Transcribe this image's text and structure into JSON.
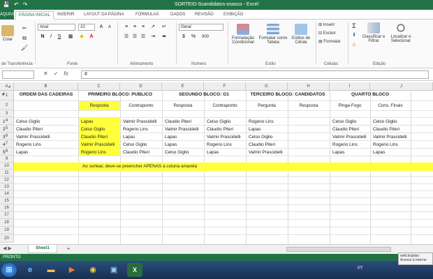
{
  "window": {
    "title": "SORTEIO-Scandidatos-osasco - Excel",
    "quick_access": [
      "💾",
      "↶",
      "↷"
    ]
  },
  "ribbon_tabs": {
    "file": "AQUIVO",
    "items": [
      "PÁGINA INICIAL",
      "INSERIR",
      "LAYOUT DA PÁGINA",
      "FÓRMULAS",
      "DADOS",
      "REVISÃO",
      "EXIBIÇÃO"
    ],
    "active": "PÁGINA INICIAL"
  },
  "ribbon": {
    "paste_label": "Colar",
    "clipboard_label": "de Transferência",
    "font_name": "Arial",
    "font_size": "10",
    "font_group_label": "Fonte",
    "bold": "N",
    "italic": "I",
    "underline": "S",
    "alignment_label": "Alinhamento",
    "number_format": "Geral",
    "number_label": "Número",
    "currency": "$",
    "percent": "%",
    "thousands": "000",
    "conditional_format": "Formatação Condicional",
    "format_table": "Formatar como Tabela",
    "cell_styles": "Estilos de Célula",
    "styles_label": "Estilo",
    "insert": "Inserir",
    "delete": "Excluir",
    "format": "Formatar",
    "cells_label": "Células",
    "sort_filter": "Classificar e Filtrar",
    "find_select": "Localizar e Selecionar",
    "editing_label": "Edição",
    "accent_color": "#217346"
  },
  "formula_bar": {
    "name_box": "",
    "fx": "fx",
    "content": "#"
  },
  "columns": [
    "A",
    "B",
    "C",
    "D",
    "E",
    "F",
    "G",
    "H",
    "I",
    "J"
  ],
  "rows": [
    "1",
    "2",
    "3",
    "4",
    "5",
    "6",
    "7",
    "8",
    "9",
    "10",
    "11",
    "12",
    "13",
    "14",
    "15",
    "16",
    "17",
    "18",
    "19",
    "20"
  ],
  "sheet": {
    "hash": "#",
    "order_header": "ORDEM DAS CADEIRAS",
    "block1": "PRIMEIRO BLOCO: PÚBLICO",
    "block2": "SEGUNDO BLOCO: G1",
    "block3": "TERCEIRO BLOCO: CANDIDATOS",
    "block4": "QUARTO BLOCO",
    "sub_headers": [
      "Resposta",
      "Contraponto",
      "Resposta",
      "Contraponto",
      "Pergunta",
      "Resposta",
      "Pinga-Fogo",
      "Cons. Finais"
    ],
    "numbers": [
      "1",
      "2",
      "3",
      "4",
      "5"
    ],
    "order": [
      "Celso Giglio",
      "Claudio Piteri",
      "Valmir Prascidelli",
      "Rogerio Lins",
      "Lapas"
    ],
    "data": [
      [
        "Lapas",
        "Valmir Prascidelli",
        "Claudio Piteri",
        "Celso Giglio",
        "Rogerio Lins",
        "",
        "Celso Giglio",
        "Celso Giglio"
      ],
      [
        "Celso Giglio",
        "Rogerio Lins",
        "Valmir Prascidelli",
        "Claudio Piteri",
        "Lapas",
        "",
        "Claudio Piteri",
        "Claudio Piteri"
      ],
      [
        "Claudio Piteri",
        "Lapas",
        "Lapas",
        "Valmir Prascidelli",
        "Celso Giglio",
        "",
        "Valmir Prascidelli",
        "Valmir Prascidelli"
      ],
      [
        "Valmir Prascidelli",
        "Celso Giglio",
        "Lapas",
        "Rogerio Lins",
        "Claudio Piteri",
        "",
        "Rogerio Lins",
        "Rogerio Lins"
      ],
      [
        "Rogerio Lins",
        "Claudio Piteri",
        "Celso Giglio",
        "Lapas",
        "Valmir Prascidelli",
        "",
        "Lapas",
        "Lapas"
      ]
    ],
    "note": "Ao sortear, deve-se preencher APENAS a coluna amarela",
    "highlight_color": "#ffff3c"
  },
  "sheet_tabs": {
    "active": "Sheet1",
    "add": "+"
  },
  "status": {
    "text": "PRONTO"
  },
  "taskbar": {
    "lang": "PT",
    "tray_note": "web.brglobo Acesso à Interne"
  }
}
